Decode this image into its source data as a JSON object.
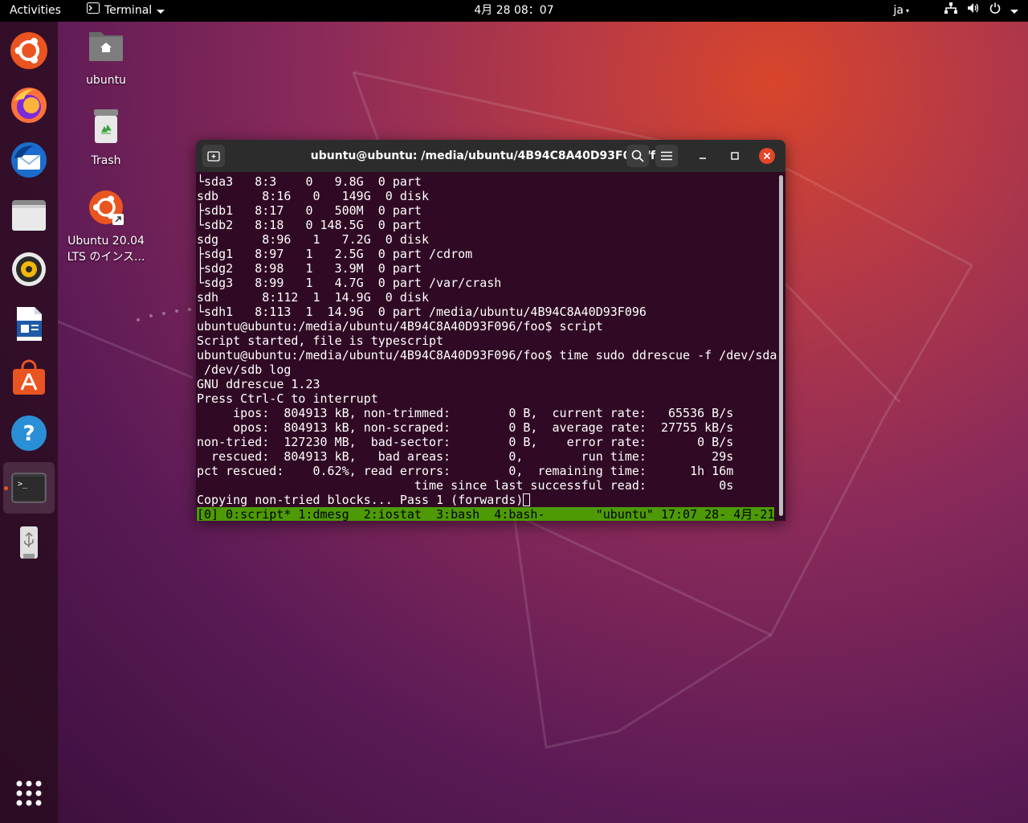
{
  "topbar": {
    "activities": "Activities",
    "app_name": "Terminal",
    "clock": "4月 28 08：07",
    "lang": "ja"
  },
  "desktop": {
    "icons": [
      {
        "label": "ubuntu"
      },
      {
        "label": "Trash"
      },
      {
        "label": "Ubuntu 20.04 LTS のインス..."
      }
    ]
  },
  "terminal": {
    "title": "ubuntu@ubuntu: /media/ubuntu/4B94C8A40D93F096/foo",
    "lines": [
      "└sda3   8:3    0   9.8G  0 part",
      "sdb      8:16   0   149G  0 disk",
      "├sdb1   8:17   0   500M  0 part",
      "└sdb2   8:18   0 148.5G  0 part",
      "sdg      8:96   1   7.2G  0 disk",
      "├sdg1   8:97   1   2.5G  0 part /cdrom",
      "├sdg2   8:98   1   3.9M  0 part",
      "└sdg3   8:99   1   4.7G  0 part /var/crash",
      "sdh      8:112  1  14.9G  0 disk",
      "└sdh1   8:113  1  14.9G  0 part /media/ubuntu/4B94C8A40D93F096",
      "ubuntu@ubuntu:/media/ubuntu/4B94C8A40D93F096/foo$ script",
      "Script started, file is typescript",
      "ubuntu@ubuntu:/media/ubuntu/4B94C8A40D93F096/foo$ time sudo ddrescue -f /dev/sda",
      " /dev/sdb log",
      "GNU ddrescue 1.23",
      "Press Ctrl-C to interrupt",
      "     ipos:  804913 kB, non-trimmed:        0 B,  current rate:   65536 B/s",
      "     opos:  804913 kB, non-scraped:        0 B,  average rate:  27755 kB/s",
      "non-tried:  127230 MB,  bad-sector:        0 B,    error rate:       0 B/s",
      "  rescued:  804913 kB,   bad areas:        0,        run time:         29s",
      "pct rescued:    0.62%, read errors:        0,  remaining time:      1h 16m",
      "                              time since last successful read:          0s"
    ],
    "last_line": "Copying non-tried blocks... Pass 1 (forwards)",
    "status_bar": "[0] 0:script* 1:dmesg  2:iostat  3:bash  4:bash-       \"ubuntu\" 17:07 28- 4月-21"
  },
  "colors": {
    "terminal_bg": "#300a24",
    "status_green": "#4e9a06",
    "ubuntu_orange": "#e95420",
    "close_red": "#e5452a"
  }
}
